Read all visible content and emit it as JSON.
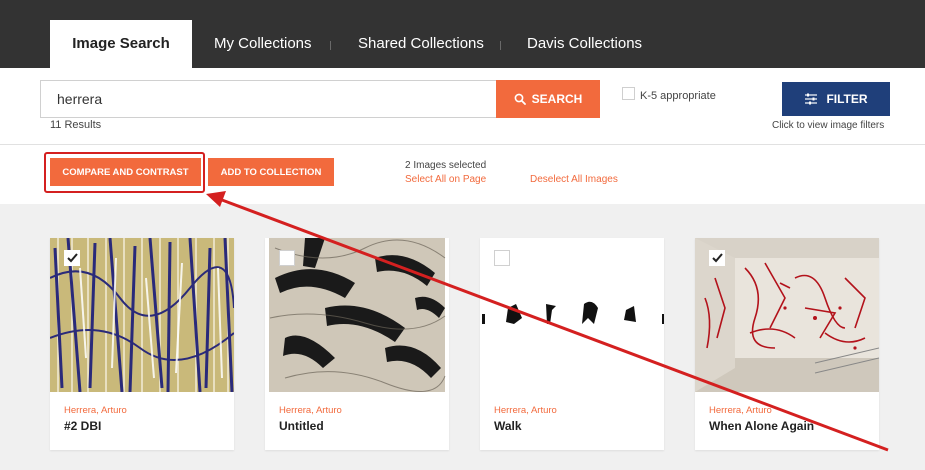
{
  "nav": {
    "tabs": [
      {
        "label": "Image Search",
        "active": true
      },
      {
        "label": "My Collections"
      },
      {
        "label": "Shared Collections"
      },
      {
        "label": "Davis Collections"
      }
    ]
  },
  "search": {
    "value": "herrera",
    "button_label": "SEARCH",
    "results": "11 Results",
    "k5_label": "K-5 appropriate",
    "k5_checked": false,
    "filter_label": "FILTER",
    "filter_hint": "Click to view image filters"
  },
  "actions": {
    "compare_label": "COMPARE AND CONTRAST",
    "add_label": "ADD TO COLLECTION",
    "selected_count": "2 Images selected",
    "select_all": "Select All on Page",
    "deselect_all": "Deselect All Images"
  },
  "cards": [
    {
      "artist": "Herrera, Arturo",
      "title": "#2 DBI",
      "checked": true
    },
    {
      "artist": "Herrera, Arturo",
      "title": "Untitled",
      "checked": false
    },
    {
      "artist": "Herrera, Arturo",
      "title": "Walk",
      "checked": false
    },
    {
      "artist": "Herrera, Arturo",
      "title": "When Alone Again",
      "checked": true
    }
  ],
  "colors": {
    "accent": "#f26a3d",
    "nav_bg": "#333333",
    "filter_bg": "#1f3f7a",
    "annotation": "#d42020"
  }
}
